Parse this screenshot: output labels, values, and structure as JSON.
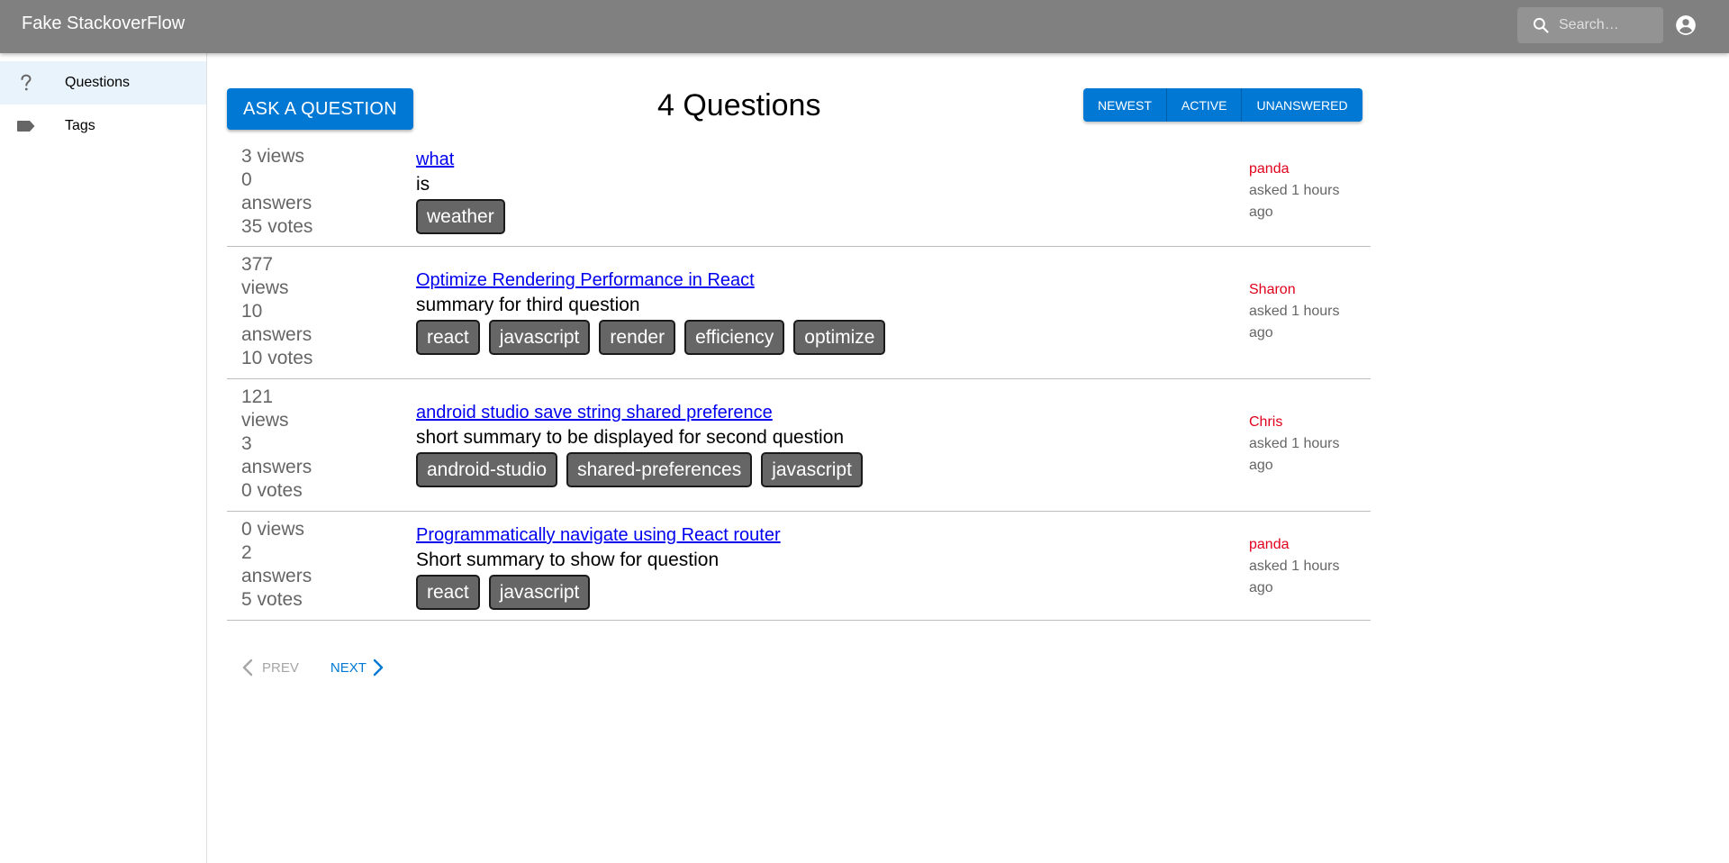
{
  "app": {
    "title": "Fake StackoverFlow"
  },
  "search": {
    "placeholder": "Search…"
  },
  "icons": {
    "search": "search-icon",
    "account": "account-circle-icon",
    "questions": "help-icon",
    "tags": "label-icon",
    "prev": "chevron-left-icon",
    "next": "chevron-right-icon"
  },
  "sidebar": {
    "items": [
      {
        "label": "Questions",
        "icon": "help-icon",
        "active": true
      },
      {
        "label": "Tags",
        "icon": "label-icon",
        "active": false
      }
    ]
  },
  "header": {
    "ask_label": "ASK A QUESTION",
    "count_title": "4 Questions",
    "sort": {
      "newest": "NEWEST",
      "active": "ACTIVE",
      "unanswered": "UNANSWERED"
    }
  },
  "questions": [
    {
      "stats": "3 views\n0\nanswers\n35 votes",
      "title": "what",
      "summary": "is",
      "tags": [
        "weather"
      ],
      "author": "panda",
      "asked": "asked 1 hours\nago"
    },
    {
      "stats": "377\nviews\n10\nanswers\n10 votes",
      "title": "Optimize Rendering Performance in React",
      "summary": "summary for third question",
      "tags": [
        "react",
        "javascript",
        "render",
        "efficiency",
        "optimize"
      ],
      "author": "Sharon",
      "asked": "asked 1 hours\nago"
    },
    {
      "stats": "121\nviews\n3\nanswers\n0 votes",
      "title": "android studio save string shared preference",
      "summary": "short summary to be displayed for second question",
      "tags": [
        "android-studio",
        "shared-preferences",
        "javascript"
      ],
      "author": "Chris",
      "asked": "asked 1 hours\nago"
    },
    {
      "stats": "0 views\n2\nanswers\n5 votes",
      "title": "Programmatically navigate using React router",
      "summary": "Short summary to show for question",
      "tags": [
        "react",
        "javascript"
      ],
      "author": "panda",
      "asked": "asked 1 hours\nago"
    }
  ],
  "pagination": {
    "prev_label": "PREV",
    "next_label": "NEXT",
    "prev_disabled": true
  },
  "colors": {
    "appbar": "#808080",
    "accent": "#0078d4",
    "author": "#e0001b",
    "tag_bg": "#666666",
    "active_nav": "#e9f3fb"
  }
}
